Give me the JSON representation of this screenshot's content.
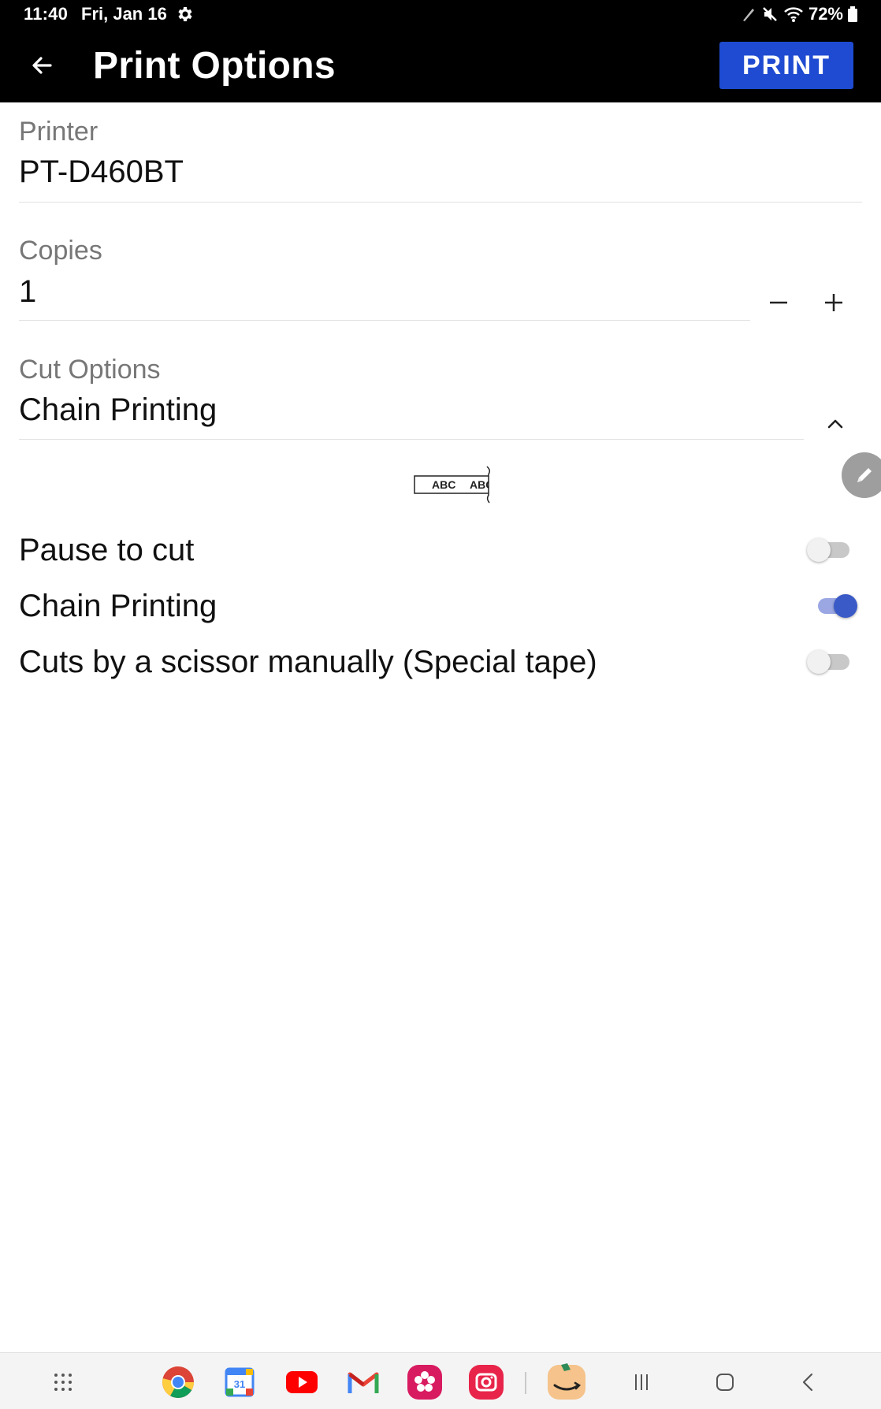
{
  "status_bar": {
    "time": "11:40",
    "date": "Fri, Jan 16",
    "battery": "72%"
  },
  "app_bar": {
    "title": "Print Options",
    "print_label": "PRINT"
  },
  "printer": {
    "label": "Printer",
    "value": "PT-D460BT"
  },
  "copies": {
    "label": "Copies",
    "value": "1"
  },
  "cut_options": {
    "label": "Cut Options",
    "value": "Chain Printing",
    "preview_text_1": "ABC",
    "preview_text_2": "ABC"
  },
  "options": [
    {
      "label": "Pause to cut",
      "enabled": false
    },
    {
      "label": "Chain Printing",
      "enabled": true
    },
    {
      "label": "Cuts by a scissor manually (Special tape)",
      "enabled": false
    }
  ],
  "dock": {
    "apps": [
      "apps-grid-icon",
      "chrome-icon",
      "calendar-icon",
      "youtube-icon",
      "gmail-icon",
      "flower-app-icon",
      "camera-app-icon",
      "amazon-icon"
    ],
    "calendar_day": "31",
    "nav": [
      "recents-icon",
      "home-icon",
      "back-nav-icon"
    ]
  },
  "colors": {
    "accent": "#1e4bd1",
    "switch_on": "#3a5ac8",
    "status_bar": "#000000"
  }
}
